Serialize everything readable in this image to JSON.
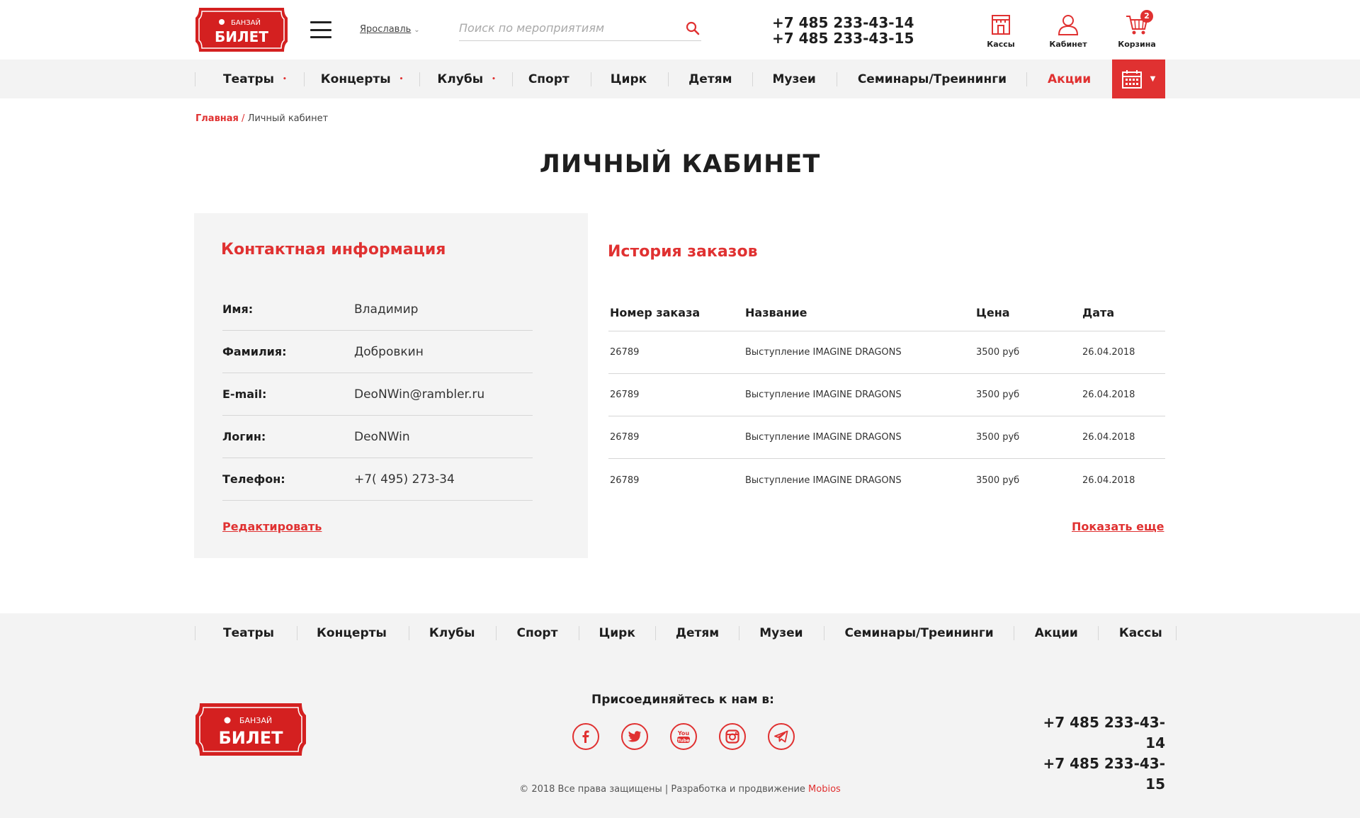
{
  "header": {
    "logo_top": "БАНЗАЙ",
    "logo_main": "БИЛЕТ",
    "city": "Ярославль",
    "search_placeholder": "Поиск по мероприятиям",
    "phones": [
      "+7 485 233-43-14",
      "+7 485 233-43-15"
    ],
    "icons": {
      "kassy": "Кассы",
      "cabinet": "Кабинет",
      "cart": "Корзина",
      "cart_count": "2"
    }
  },
  "nav": {
    "items": [
      {
        "label": "Театры"
      },
      {
        "label": "Концерты"
      },
      {
        "label": "Клубы"
      },
      {
        "label": "Спорт"
      },
      {
        "label": "Цирк"
      },
      {
        "label": "Детям"
      },
      {
        "label": "Музеи"
      },
      {
        "label": "Семинары/Треининги"
      },
      {
        "label": "Акции"
      }
    ],
    "dropdown_marker": "•",
    "calendar_icon": "calendar-icon"
  },
  "breadcrumb": {
    "home": "Главная",
    "separator": "/",
    "current": "Личный кабинет"
  },
  "page_title": "ЛИЧНЫЙ КАБИНЕТ",
  "contact": {
    "title": "Контактная информация",
    "rows": [
      {
        "label": "Имя:",
        "value": "Владимир"
      },
      {
        "label": "Фамилия:",
        "value": "Добровкин"
      },
      {
        "label": "E-mail:",
        "value": "DeoNWin@rambler.ru"
      },
      {
        "label": "Логин:",
        "value": "DeoNWin"
      },
      {
        "label": "Телефон:",
        "value": "+7( 495) 273-34"
      }
    ],
    "edit_label": "Редактировать"
  },
  "orders": {
    "title": "История заказов",
    "columns": [
      "Номер заказа",
      "Название",
      "Цена",
      "Дата"
    ],
    "rows": [
      [
        "26789",
        "Выступление IMAGINE DRAGONS",
        "3500 руб",
        "26.04.2018"
      ],
      [
        "26789",
        "Выступление IMAGINE DRAGONS",
        "3500 руб",
        "26.04.2018"
      ],
      [
        "26789",
        "Выступление IMAGINE DRAGONS",
        "3500 руб",
        "26.04.2018"
      ],
      [
        "26789",
        "Выступление IMAGINE DRAGONS",
        "3500 руб",
        "26.04.2018"
      ]
    ],
    "more_label": "Показать еще"
  },
  "footer": {
    "nav": [
      "Театры",
      "Концерты",
      "Клубы",
      "Спорт",
      "Цирк",
      "Детям",
      "Музеи",
      "Семинары/Треининги",
      "Акции",
      "Кассы"
    ],
    "join_label": "Присоединяйтесь к нам в:",
    "socials": [
      "facebook-icon",
      "twitter-icon",
      "youtube-icon",
      "instagram-icon",
      "telegram-icon"
    ],
    "phones": [
      "+7 485 233-43-14",
      "+7 485 233-43-15"
    ],
    "copyright": "© 2018 Все права защищены | Разработка и продвижение",
    "dev_link": "Mobios"
  },
  "colors": {
    "accent": "#e03131",
    "panel_bg": "#f4f4f4",
    "nav_bg": "#f3f3f3"
  }
}
